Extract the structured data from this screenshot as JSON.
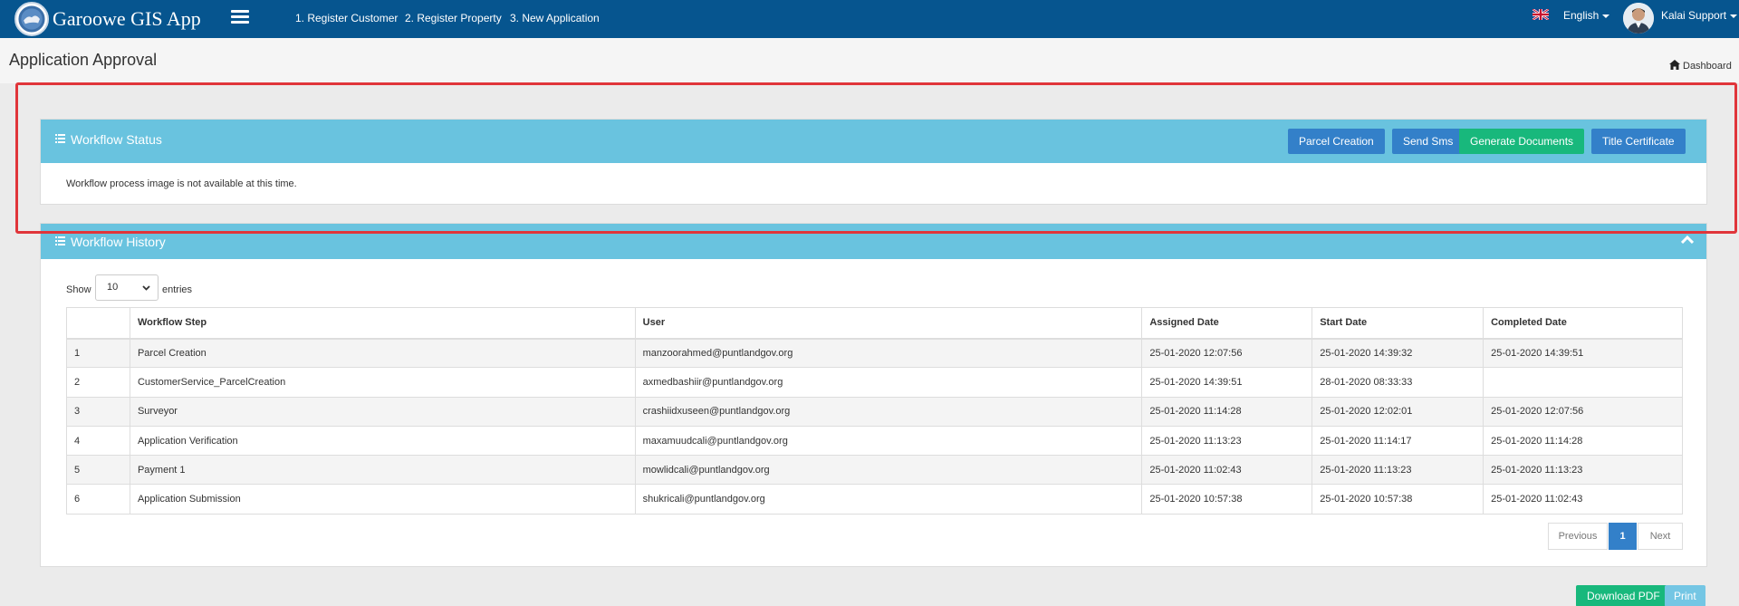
{
  "navbar": {
    "app_title": "Garoowe GIS App",
    "links": [
      "1. Register Customer",
      "2. Register Property",
      "3. New Application"
    ],
    "language": "English",
    "user_name": "Kalai Support"
  },
  "page": {
    "title": "Application Approval",
    "breadcrumb": "Dashboard"
  },
  "workflow_status": {
    "title": "Workflow Status",
    "buttons": {
      "parcel_creation": "Parcel Creation",
      "send_sms": "Send Sms",
      "generate_documents": "Generate Documents",
      "title_certificate": "Title Certificate"
    },
    "message": "Workflow process image is not available at this time."
  },
  "workflow_history": {
    "title": "Workflow History",
    "show_label": "Show",
    "entries_value": "10",
    "entries_label": "entries",
    "columns": [
      "",
      "Workflow Step",
      "User",
      "Assigned Date",
      "Start Date",
      "Completed Date"
    ],
    "rows": [
      [
        "1",
        "Parcel Creation",
        "manzoorahmed@puntlandgov.org",
        "25-01-2020 12:07:56",
        "25-01-2020 14:39:32",
        "25-01-2020 14:39:51"
      ],
      [
        "2",
        "CustomerService_ParcelCreation",
        "axmedbashiir@puntlandgov.org",
        "25-01-2020 14:39:51",
        "28-01-2020 08:33:33",
        ""
      ],
      [
        "3",
        "Surveyor",
        "crashiidxuseen@puntlandgov.org",
        "25-01-2020 11:14:28",
        "25-01-2020 12:02:01",
        "25-01-2020 12:07:56"
      ],
      [
        "4",
        "Application Verification",
        "maxamuudcali@puntlandgov.org",
        "25-01-2020 11:13:23",
        "25-01-2020 11:14:17",
        "25-01-2020 11:14:28"
      ],
      [
        "5",
        "Payment 1",
        "mowlidcali@puntlandgov.org",
        "25-01-2020 11:02:43",
        "25-01-2020 11:13:23",
        "25-01-2020 11:13:23"
      ],
      [
        "6",
        "Application Submission",
        "shukricali@puntlandgov.org",
        "25-01-2020 10:57:38",
        "25-01-2020 10:57:38",
        "25-01-2020 11:02:43"
      ]
    ],
    "pagination": {
      "previous": "Previous",
      "current": "1",
      "next": "Next"
    }
  },
  "footer_buttons": {
    "download_pdf": "Download PDF",
    "print": "Print"
  },
  "colors": {
    "navbar": "#06558f",
    "panel_heading": "#69c3df",
    "primary": "#3380c9",
    "success": "#18b87c",
    "highlight": "#e0353a"
  }
}
